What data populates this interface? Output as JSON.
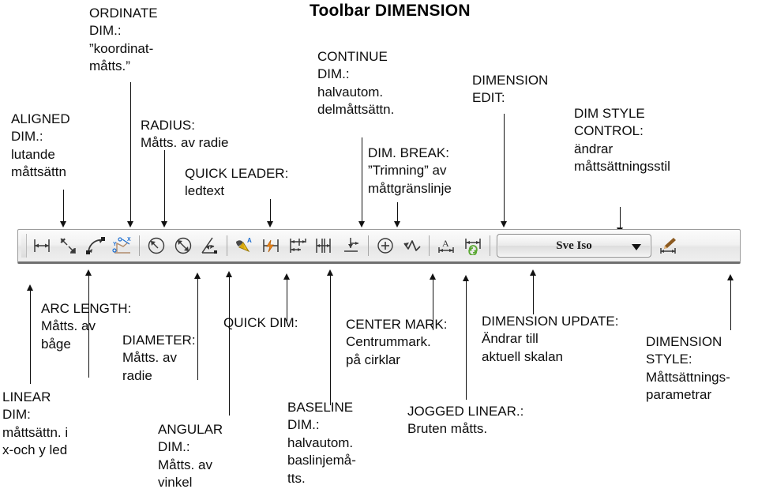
{
  "title": "Toolbar  DIMENSION",
  "top_annotations": [
    {
      "id": "aligned-dim",
      "text": "ALIGNED\nDIM.:\nlutande\nmåttsättn"
    },
    {
      "id": "ordinate-dim",
      "text": "ORDINATE\nDIM.:\n”koordinat-\nmåtts.”"
    },
    {
      "id": "radius",
      "text": "RADIUS:\nMåtts. av radie"
    },
    {
      "id": "quick-leader",
      "text": "QUICK LEADER:\nledtext"
    },
    {
      "id": "continue-dim",
      "text": "CONTINUE\nDIM.:\nhalvautom.\ndelmåttsättn."
    },
    {
      "id": "dim-break",
      "text": "DIM. BREAK:\n”Trimning” av\nmåttgränslinje"
    },
    {
      "id": "dimension-edit",
      "text": "DIMENSION\nEDIT:"
    },
    {
      "id": "dim-style-control",
      "text": "DIM STYLE\nCONTROL:\nändrar\nmåttsättningsstil"
    }
  ],
  "bottom_annotations": [
    {
      "id": "linear-dim",
      "text": "LINEAR\nDIM:\nmåttsättn. i\nx-och y led"
    },
    {
      "id": "arc-length",
      "text": "ARC LENGTH:\nMåtts. av\nbåge"
    },
    {
      "id": "diameter",
      "text": "DIAMETER:\nMåtts. av\nradie"
    },
    {
      "id": "angular-dim",
      "text": "ANGULAR\nDIM.:\nMåtts. av\nvinkel"
    },
    {
      "id": "quick-dim",
      "text": "QUICK DIM:"
    },
    {
      "id": "baseline-dim",
      "text": "BASELINE\nDIM.:\nhalvautom.\nbaslinjemå-\ntts."
    },
    {
      "id": "center-mark",
      "text": "CENTER MARK:\nCentrummark.\npå cirklar"
    },
    {
      "id": "jogged-linear",
      "text": "JOGGED LINEAR.:\nBruten måtts."
    },
    {
      "id": "dimension-update",
      "text": "DIMENSION UPDATE:\nÄndrar till\naktuell skalan"
    },
    {
      "id": "dimension-style",
      "text": "DIMENSION\nSTYLE:\nMåttsättnings-\nparametrar"
    }
  ],
  "toolbar": {
    "style_combo": {
      "value": "Sve Iso",
      "caret": "chevron-down-icon"
    },
    "buttons": [
      {
        "id": "linear-dimension",
        "icon": "linear-dimension-icon"
      },
      {
        "id": "aligned-dimension",
        "icon": "aligned-dimension-icon"
      },
      {
        "id": "arc-length-dimension",
        "icon": "arc-length-dimension-icon"
      },
      {
        "id": "ordinate-dimension",
        "icon": "ordinate-dimension-icon"
      },
      {
        "id": "radius-dimension",
        "icon": "radius-dimension-icon"
      },
      {
        "id": "diameter-dimension",
        "icon": "diameter-dimension-icon"
      },
      {
        "id": "angular-dimension",
        "icon": "angular-dimension-icon"
      },
      {
        "id": "quick-leader",
        "icon": "quick-leader-icon"
      },
      {
        "id": "quick-dimension",
        "icon": "quick-dimension-icon"
      },
      {
        "id": "baseline-dimension",
        "icon": "baseline-dimension-icon"
      },
      {
        "id": "continue-dimension",
        "icon": "continue-dimension-icon"
      },
      {
        "id": "dimension-space",
        "icon": "dimension-space-icon"
      },
      {
        "id": "center-mark",
        "icon": "center-mark-icon"
      },
      {
        "id": "dimension-break",
        "icon": "dimension-break-icon"
      },
      {
        "id": "dimension-edit",
        "icon": "dimension-edit-icon"
      },
      {
        "id": "dimension-update",
        "icon": "dimension-update-icon"
      },
      {
        "id": "dimension-style",
        "icon": "dimension-style-brush-icon"
      }
    ]
  },
  "colors": {
    "ink": "#0d0d0d",
    "toolbar_face": "#f0f0f0",
    "toolbar_border": "#9c9c9c",
    "icon_line": "#3a3a3a",
    "accent_blue": "#1f6fd0",
    "accent_yellow": "#f2c21c",
    "accent_orange": "#f08a1c",
    "accent_green": "#5aa832",
    "accent_brown": "#8c5a20"
  }
}
